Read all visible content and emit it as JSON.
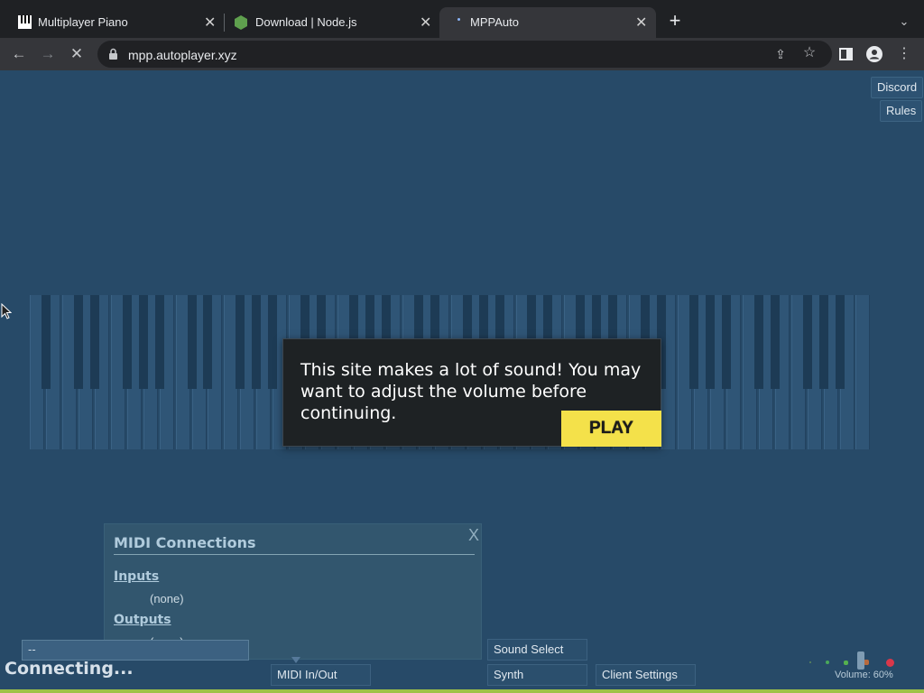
{
  "browser": {
    "tabs": [
      {
        "title": "Multiplayer Piano",
        "icon": "piano-icon"
      },
      {
        "title": "Download | Node.js",
        "icon": "nodejs-icon"
      },
      {
        "title": "MPPAuto",
        "icon": "loading-icon"
      }
    ],
    "url": "mpp.autoplayer.xyz"
  },
  "page": {
    "top_buttons": {
      "discord": "Discord",
      "rules": "Rules"
    },
    "modal": {
      "text": "This site makes a lot of sound! You may want to adjust the volume before continuing.",
      "play": "PLAY"
    },
    "midi": {
      "title": "MIDI Connections",
      "close": "X",
      "inputs_label": "Inputs",
      "inputs_value": "(none)",
      "outputs_label": "Outputs",
      "outputs_value": "(none)"
    },
    "chat_input_value": "--",
    "status": "Connecting...",
    "bottom_buttons": {
      "midi": "MIDI In/Out",
      "sound_select": "Sound Select",
      "synth": "Synth",
      "client_settings": "Client Settings"
    },
    "volume": "Volume: 60%"
  },
  "colors": {
    "page_bg": "#274a68",
    "play_button": "#f4e14a",
    "modal_bg": "#1e2224"
  }
}
